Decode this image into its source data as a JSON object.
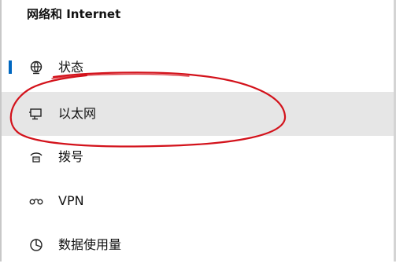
{
  "header": {
    "title": "网络和 Internet"
  },
  "nav": {
    "items": [
      {
        "label": "状态",
        "icon": "globe-icon",
        "active": true
      },
      {
        "label": "以太网",
        "icon": "ethernet-icon",
        "selected": true
      },
      {
        "label": "拨号",
        "icon": "dialup-icon"
      },
      {
        "label": "VPN",
        "icon": "vpn-icon"
      },
      {
        "label": "数据使用量",
        "icon": "data-usage-icon"
      }
    ]
  },
  "colors": {
    "accent": "#0067c0",
    "selected_bg": "#e6e6e6",
    "annotation": "#d3121b"
  }
}
